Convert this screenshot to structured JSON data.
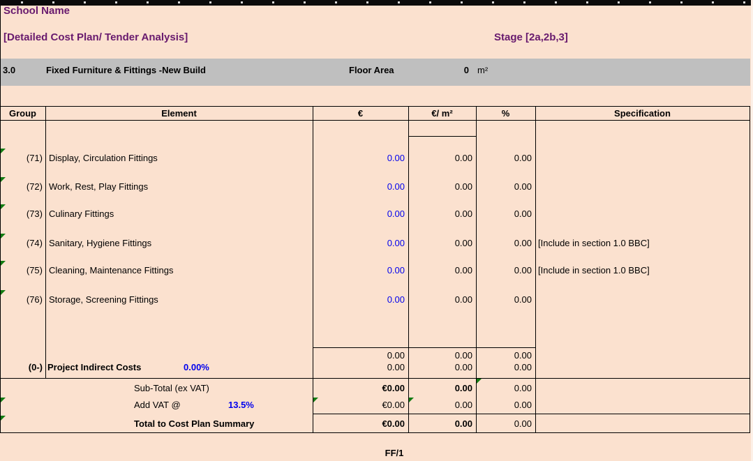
{
  "header": {
    "school_name": "School Name",
    "doc_title": "[Detailed Cost Plan/ Tender Analysis]",
    "stage": "Stage [2a,2b,3]"
  },
  "section_bar": {
    "number": "3.0",
    "title": "Fixed Furniture & Fittings -New Build",
    "floor_area_label": "Floor Area",
    "floor_area_value": "0",
    "floor_area_unit": "m²"
  },
  "table": {
    "headers": {
      "group": "Group",
      "element": "Element",
      "euro": "€",
      "euro_m2": "€/ m²",
      "percent": "%",
      "specification": "Specification"
    },
    "rows": [
      {
        "group": "(71)",
        "element": "Display, Circulation Fittings",
        "euro": "0.00",
        "euro_m2": "0.00",
        "percent": "0.00",
        "spec": ""
      },
      {
        "group": "(72)",
        "element": "Work, Rest, Play Fittings",
        "euro": "0.00",
        "euro_m2": "0.00",
        "percent": "0.00",
        "spec": ""
      },
      {
        "group": "(73)",
        "element": "Culinary Fittings",
        "euro": "0.00",
        "euro_m2": "0.00",
        "percent": "0.00",
        "spec": ""
      },
      {
        "group": "(74)",
        "element": "Sanitary, Hygiene Fittings",
        "euro": "0.00",
        "euro_m2": "0.00",
        "percent": "0.00",
        "spec": "[Include in section 1.0 BBC]"
      },
      {
        "group": "(75)",
        "element": "Cleaning, Maintenance Fittings",
        "euro": "0.00",
        "euro_m2": "0.00",
        "percent": "0.00",
        "spec": "[Include in section 1.0 BBC]"
      },
      {
        "group": "(76)",
        "element": "Storage, Screening Fittings",
        "euro": "0.00",
        "euro_m2": "0.00",
        "percent": "0.00",
        "spec": ""
      }
    ],
    "subtotal_block": {
      "blank_row": {
        "euro": "0.00",
        "euro_m2": "0.00",
        "percent": "0.00"
      },
      "indirect": {
        "group": "(0-)",
        "label": "Project Indirect Costs",
        "rate": "0.00%",
        "euro": "0.00",
        "euro_m2": "0.00",
        "percent": "0.00"
      }
    },
    "totals": {
      "subtotal": {
        "label": "Sub-Total (ex VAT)",
        "euro": "€0.00",
        "euro_m2": "0.00",
        "percent": "0.00"
      },
      "vat": {
        "label": "Add VAT @",
        "rate": "13.5%",
        "euro": "€0.00",
        "euro_m2": "0.00",
        "percent": "0.00"
      },
      "total": {
        "label": "Total to Cost Plan Summary",
        "euro": "€0.00",
        "euro_m2": "0.00",
        "percent": "0.00"
      }
    }
  },
  "footer": {
    "page_ref": "FF/1"
  },
  "colors": {
    "background_peach": "#fbe1cf",
    "section_bar_gray": "#bfbfbf",
    "title_purple": "#681a6e",
    "value_blue": "#0000ee",
    "error_marker_green": "#127b12",
    "grid_black": "#000000"
  }
}
